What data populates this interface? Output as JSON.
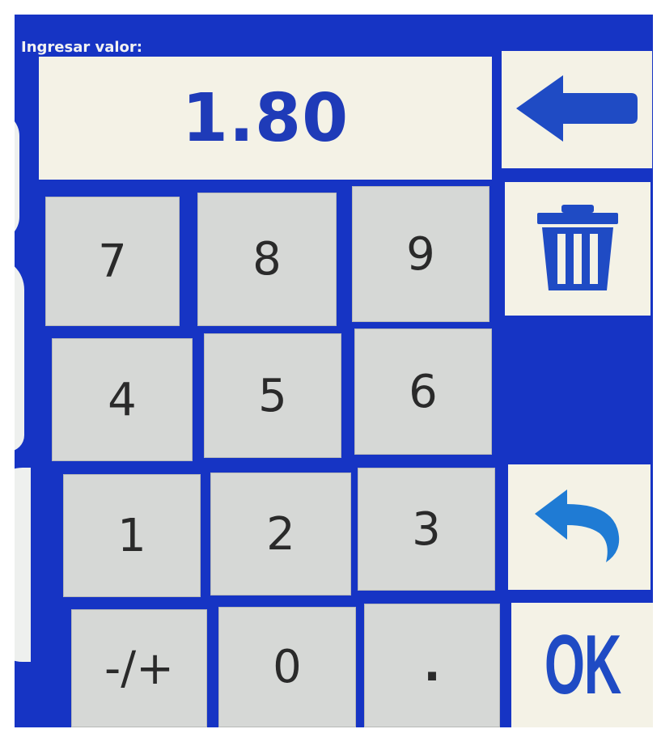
{
  "prompt": "Ingresar valor:",
  "display": {
    "value": "1.80"
  },
  "keys": {
    "k7": "7",
    "k8": "8",
    "k9": "9",
    "k4": "4",
    "k5": "5",
    "k6": "6",
    "k1": "1",
    "k2": "2",
    "k3": "3",
    "sign": "-/+",
    "k0": "0",
    "dot": "."
  },
  "side": {
    "backspace_icon": "left-arrow-icon",
    "clear_icon": "trash-icon",
    "undo_icon": "undo-icon",
    "ok_label": "OK"
  },
  "colors": {
    "panel": "#1634c4",
    "display_bg": "#f4f2e6",
    "key_bg": "#d6d8d6",
    "accent": "#1f4bc4"
  }
}
